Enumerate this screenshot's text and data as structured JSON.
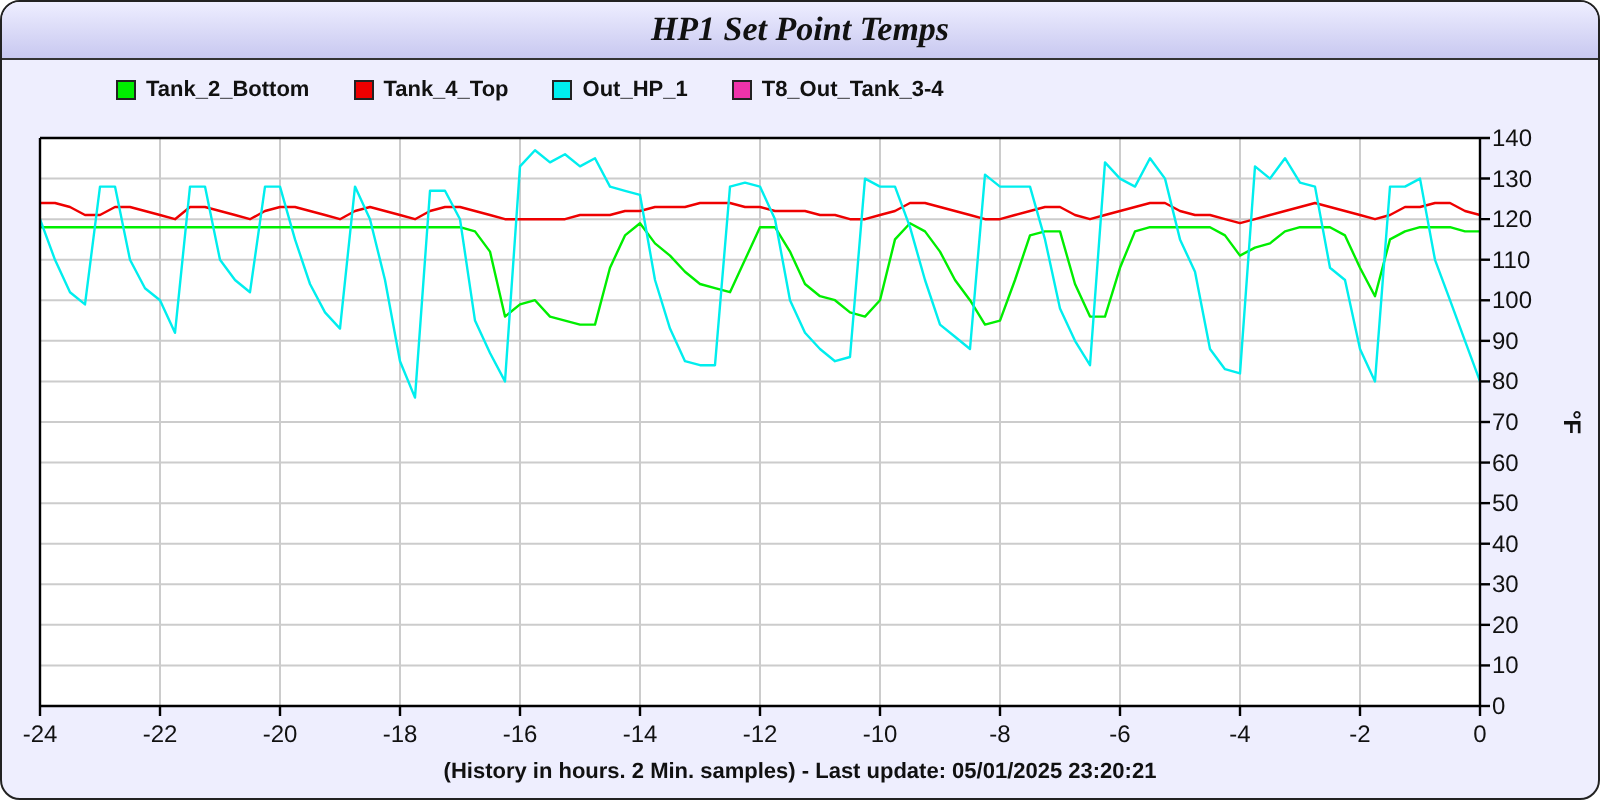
{
  "chart_data": {
    "type": "line",
    "grid": true,
    "title": "HP1 Set Point Temps",
    "xlabel": "(History in hours. 2 Min. samples) - Last update: 05/01/2025 23:20:21",
    "ylabel": "°F",
    "xlim": [
      -24,
      0
    ],
    "ylim": [
      0,
      140
    ],
    "xticks": [
      -24,
      -22,
      -20,
      -18,
      -16,
      -14,
      -12,
      -10,
      -8,
      -6,
      -4,
      -2,
      0
    ],
    "yticks": [
      0,
      10,
      20,
      30,
      40,
      50,
      60,
      70,
      80,
      90,
      100,
      110,
      120,
      130,
      140
    ],
    "x": [
      -24,
      -23.75,
      -23.5,
      -23.25,
      -23,
      -22.75,
      -22.5,
      -22.25,
      -22,
      -21.75,
      -21.5,
      -21.25,
      -21,
      -20.75,
      -20.5,
      -20.25,
      -20,
      -19.75,
      -19.5,
      -19.25,
      -19,
      -18.75,
      -18.5,
      -18.25,
      -18,
      -17.75,
      -17.5,
      -17.25,
      -17,
      -16.75,
      -16.5,
      -16.25,
      -16,
      -15.75,
      -15.5,
      -15.25,
      -15,
      -14.75,
      -14.5,
      -14.25,
      -14,
      -13.75,
      -13.5,
      -13.25,
      -13,
      -12.75,
      -12.5,
      -12.25,
      -12,
      -11.75,
      -11.5,
      -11.25,
      -11,
      -10.75,
      -10.5,
      -10.25,
      -10,
      -9.75,
      -9.5,
      -9.25,
      -9,
      -8.75,
      -8.5,
      -8.25,
      -8,
      -7.75,
      -7.5,
      -7.25,
      -7,
      -6.75,
      -6.5,
      -6.25,
      -6,
      -5.75,
      -5.5,
      -5.25,
      -5,
      -4.75,
      -4.5,
      -4.25,
      -4,
      -3.75,
      -3.5,
      -3.25,
      -3,
      -2.75,
      -2.5,
      -2.25,
      -2,
      -1.75,
      -1.5,
      -1.25,
      -1,
      -0.75,
      -0.5,
      -0.25,
      0
    ],
    "series": [
      {
        "name": "Tank_2_Bottom",
        "color": "#00ee00",
        "values": [
          118,
          118,
          118,
          118,
          118,
          118,
          118,
          118,
          118,
          118,
          118,
          118,
          118,
          118,
          118,
          118,
          118,
          118,
          118,
          118,
          118,
          118,
          118,
          118,
          118,
          118,
          118,
          118,
          118,
          117,
          112,
          96,
          99,
          100,
          96,
          95,
          94,
          94,
          108,
          116,
          119,
          114,
          111,
          107,
          104,
          103,
          102,
          110,
          118,
          118,
          112,
          104,
          101,
          100,
          97,
          96,
          100,
          115,
          119,
          117,
          112,
          105,
          100,
          94,
          95,
          105,
          116,
          117,
          117,
          104,
          96,
          96,
          108,
          117,
          118,
          118,
          118,
          118,
          118,
          116,
          111,
          113,
          114,
          117,
          118,
          118,
          118,
          116,
          108,
          101,
          115,
          117,
          118,
          118,
          118,
          117,
          117
        ]
      },
      {
        "name": "Tank_4_Top",
        "color": "#ee0000",
        "values": [
          124,
          124,
          123,
          121,
          121,
          123,
          123,
          122,
          121,
          120,
          123,
          123,
          122,
          121,
          120,
          122,
          123,
          123,
          122,
          121,
          120,
          122,
          123,
          122,
          121,
          120,
          122,
          123,
          123,
          122,
          121,
          120,
          120,
          120,
          120,
          120,
          121,
          121,
          121,
          122,
          122,
          123,
          123,
          123,
          124,
          124,
          124,
          123,
          123,
          122,
          122,
          122,
          121,
          121,
          120,
          120,
          121,
          122,
          124,
          124,
          123,
          122,
          121,
          120,
          120,
          121,
          122,
          123,
          123,
          121,
          120,
          121,
          122,
          123,
          124,
          124,
          122,
          121,
          121,
          120,
          119,
          120,
          121,
          122,
          123,
          124,
          123,
          122,
          121,
          120,
          121,
          123,
          123,
          124,
          124,
          122,
          121
        ]
      },
      {
        "name": "Out_HP_1",
        "color": "#00eeee",
        "values": [
          120,
          110,
          102,
          99,
          128,
          128,
          110,
          103,
          100,
          92,
          128,
          128,
          110,
          105,
          102,
          128,
          128,
          115,
          104,
          97,
          93,
          128,
          120,
          105,
          85,
          76,
          127,
          127,
          120,
          95,
          87,
          80,
          133,
          137,
          134,
          136,
          133,
          135,
          128,
          127,
          126,
          105,
          93,
          85,
          84,
          84,
          128,
          129,
          128,
          120,
          100,
          92,
          88,
          85,
          86,
          130,
          128,
          128,
          118,
          105,
          94,
          91,
          88,
          131,
          128,
          128,
          128,
          115,
          98,
          90,
          84,
          134,
          130,
          128,
          135,
          130,
          115,
          107,
          88,
          83,
          82,
          133,
          130,
          135,
          129,
          128,
          108,
          105,
          88,
          80,
          128,
          128,
          130,
          110,
          100,
          90,
          80
        ]
      },
      {
        "name": "T8_Out_Tank_3-4",
        "color": "#ee33aa",
        "values": [
          null,
          null,
          null,
          null,
          null,
          null,
          null,
          null,
          null,
          null,
          null,
          null,
          null,
          null,
          null,
          null,
          null,
          null,
          null,
          null,
          null,
          null,
          null,
          null,
          null,
          null,
          null,
          null,
          null,
          null,
          null,
          null,
          null,
          null,
          null,
          null,
          null,
          null,
          null,
          null,
          null,
          null,
          null,
          null,
          null,
          null,
          null,
          null,
          null,
          null,
          null,
          null,
          null,
          null,
          null,
          null,
          null,
          null,
          null,
          null,
          null,
          null,
          null,
          null,
          null,
          null,
          null,
          null,
          null,
          null,
          null,
          null,
          null,
          null,
          null,
          null,
          null,
          null,
          null,
          null,
          null,
          null,
          null,
          null,
          null,
          null,
          null,
          null,
          null,
          null,
          null,
          null,
          null,
          null,
          null,
          null,
          null
        ]
      }
    ]
  }
}
